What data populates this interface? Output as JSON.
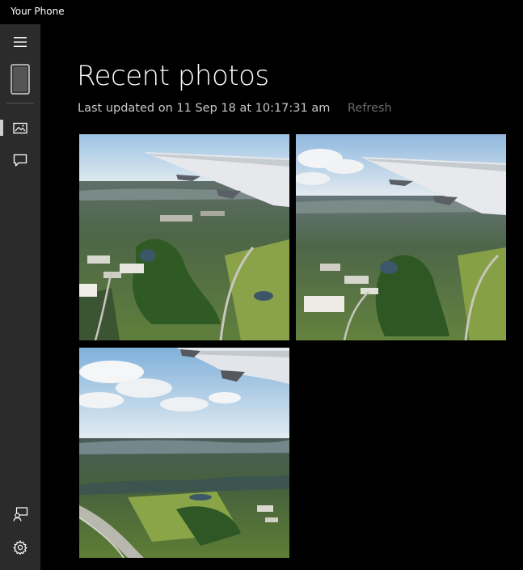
{
  "window": {
    "title": "Your Phone"
  },
  "sidebar": {
    "items": [
      {
        "name": "menu",
        "icon": "hamburger-menu-icon"
      },
      {
        "name": "phone",
        "icon": "phone-icon"
      },
      {
        "name": "photos",
        "icon": "photos-icon",
        "selected": true
      },
      {
        "name": "messages",
        "icon": "message-icon"
      },
      {
        "name": "feedback",
        "icon": "feedback-icon"
      },
      {
        "name": "settings",
        "icon": "gear-icon"
      }
    ]
  },
  "main": {
    "title": "Recent photos",
    "last_updated": "Last updated on 11 Sep 18 at 10:17:31 am",
    "refresh_label": "Refresh",
    "photos": [
      {
        "subject": "aerial view from airplane wing over suburb and forest"
      },
      {
        "subject": "aerial view from airplane wing over suburb and forest"
      },
      {
        "subject": "aerial view with clouds and highway below"
      }
    ]
  },
  "colors": {
    "background": "#000000",
    "sidebar": "#2b2b2b",
    "text_primary": "#ffffff",
    "text_secondary": "#c8c8c8",
    "text_disabled": "#6b6b6b"
  }
}
